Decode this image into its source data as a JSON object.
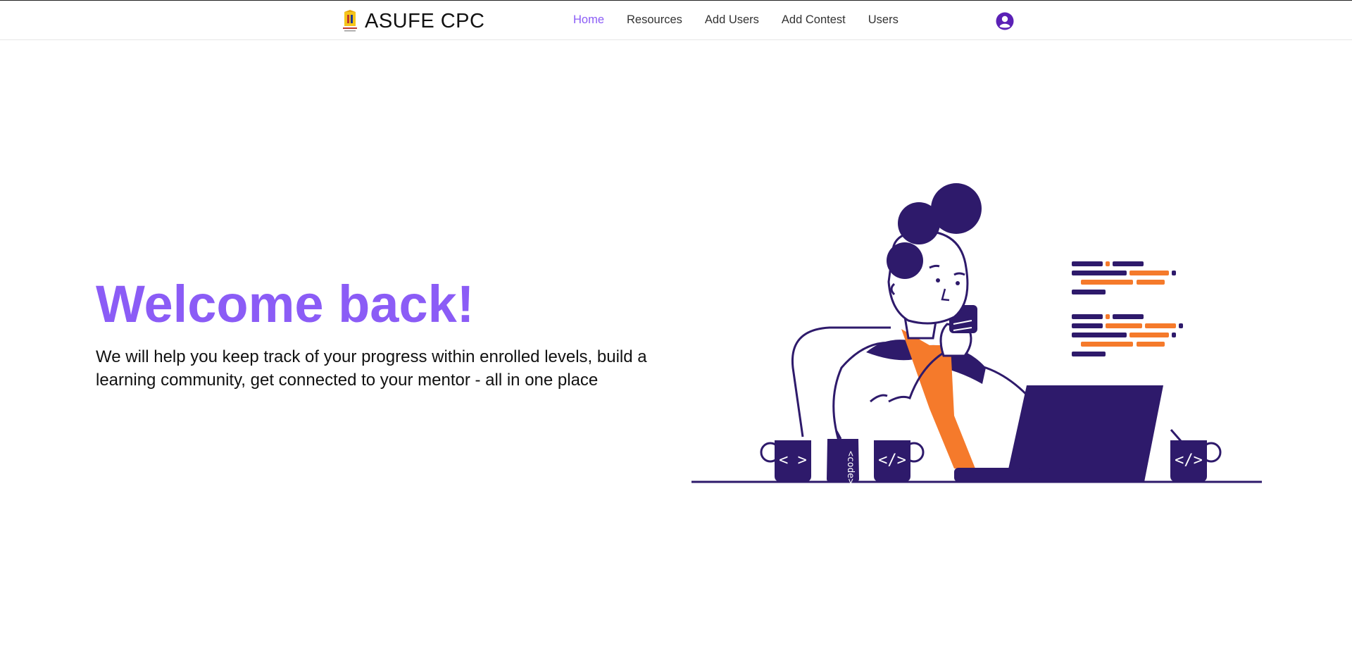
{
  "navbar": {
    "brand": "ASUFE CPC",
    "links": [
      {
        "label": "Home",
        "active": true
      },
      {
        "label": "Resources"
      },
      {
        "label": "Add Users"
      },
      {
        "label": "Add Contest"
      },
      {
        "label": "Users"
      }
    ],
    "profile_icon": "user-circle-icon"
  },
  "hero": {
    "title": "Welcome back!",
    "description": "We will help you keep track of your progress within enrolled levels, build a learning community, get connected to your mentor - all in one place"
  },
  "illustration": {
    "mug_left": "< >",
    "can": "<code>",
    "mug_middle": "</>",
    "mug_right": "</>"
  },
  "colors": {
    "accent": "#8b5cf6",
    "illustration_dark": "#2e1a6b",
    "illustration_orange": "#f57a2b"
  }
}
